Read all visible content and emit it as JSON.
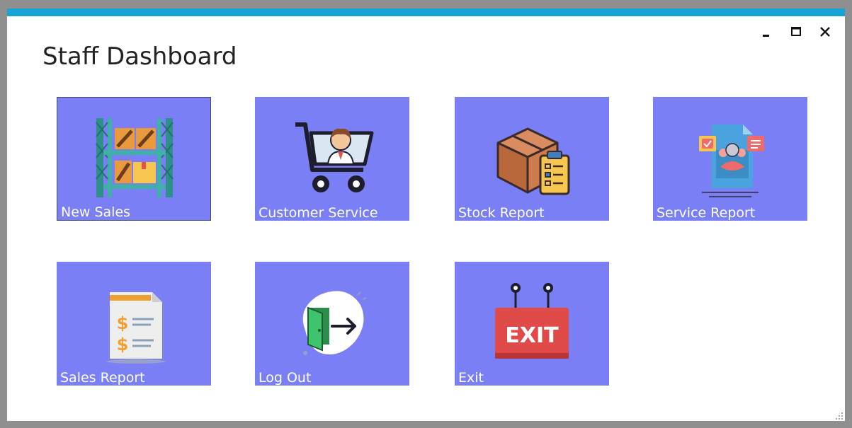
{
  "window": {
    "title": "Staff Dashboard",
    "accent_color": "#17a4d4",
    "controls": {
      "minimize": "minimize-icon",
      "maximize": "maximize-icon",
      "close": "close-icon"
    }
  },
  "tiles": [
    {
      "label": "New Sales",
      "icon": "warehouse-shelves-icon"
    },
    {
      "label": "Customer Service",
      "icon": "shopping-cart-person-icon"
    },
    {
      "label": "Stock Report",
      "icon": "box-clipboard-icon"
    },
    {
      "label": "Service Report",
      "icon": "document-person-icon"
    },
    {
      "label": "Sales Report",
      "icon": "dollar-document-icon"
    },
    {
      "label": "Log Out",
      "icon": "door-arrow-icon"
    },
    {
      "label": "Exit",
      "icon": "exit-sign-icon"
    }
  ],
  "colors": {
    "tile_bg": "#7b7ff6",
    "tile_text": "#ffffff"
  }
}
